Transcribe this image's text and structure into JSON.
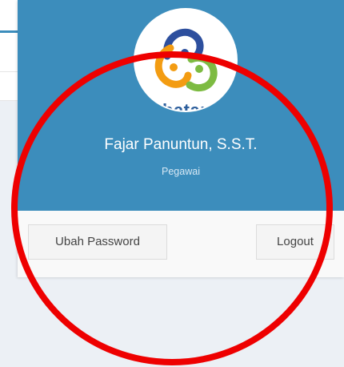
{
  "user_menu": {
    "logo_fragment": "batan",
    "name": "Fajar Panuntun, S.S.T.",
    "role": "Pegawai",
    "change_password_label": "Ubah Password",
    "logout_label": "Logout"
  },
  "colors": {
    "header_bg": "#3c8dbc",
    "footer_bg": "#f9f9f9",
    "annotation": "#ee0000"
  }
}
